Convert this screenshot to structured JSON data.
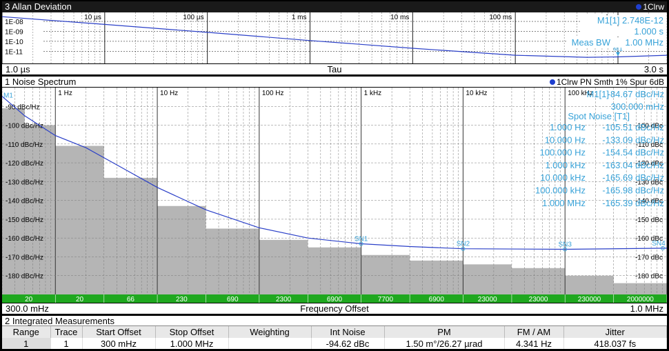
{
  "colors": {
    "trace": "#2a3fc8",
    "marker": "#37a2d8",
    "fill": "#b5b5b5",
    "grid": "#7a7a7a",
    "band": "#1fa81f"
  },
  "allan": {
    "title": "3 Allan Deviation",
    "trace_label": "1Clrw",
    "x_left": "1.0 µs",
    "x_center": "Tau",
    "x_right": "3.0 s",
    "marker_name": "M1",
    "marker_text_1": "M1[1] 2.748E-12",
    "marker_text_2": "1.000 s",
    "meas_bw_label": "Meas BW",
    "meas_bw_value": "1.00 MHz"
  },
  "noise": {
    "title": "1 Noise Spectrum",
    "trace_label": "1Clrw PN Smth 1% Spur 6dB",
    "marker_name": "M1",
    "marker_readout": "M1[1]",
    "marker_value": "-84.67 dBc/Hz",
    "marker_freq": "300.000 mHz",
    "spot_title": "Spot Noise [T1]",
    "spot_rows": [
      {
        "f": "1.000 Hz",
        "v": "-105.51 dBc/Hz"
      },
      {
        "f": "10.000 Hz",
        "v": "-133.09 dBc/Hz"
      },
      {
        "f": "100.000 Hz",
        "v": "-154.54 dBc/Hz"
      },
      {
        "f": "1.000 kHz",
        "v": "-163.04 dBc/Hz"
      },
      {
        "f": "10.000 kHz",
        "v": "-165.69 dBc/Hz"
      },
      {
        "f": "100.000 kHz",
        "v": "-165.98 dBc/Hz"
      },
      {
        "f": "1.000 MHz",
        "v": "-165.39 dBc/Hz"
      }
    ],
    "x_left": "300.0 mHz",
    "x_center": "Frequency Offset",
    "x_right": "1.0 MHz"
  },
  "integrated": {
    "title": "2 Integrated Measurements",
    "headers": [
      "Range",
      "Trace",
      "Start Offset",
      "Stop Offset",
      "Weighting",
      "Int Noise",
      "PM",
      "FM / AM",
      "Jitter"
    ],
    "row": [
      "1",
      "1",
      "300 mHz",
      "1.000 MHz",
      "",
      "-94.62 dBc",
      "1.50 m°/26.27 µrad",
      "4.341 Hz",
      "418.037 fs"
    ]
  },
  "chart_data": [
    {
      "type": "line",
      "title": "3 Allan Deviation",
      "xlabel": "Tau",
      "x_scale": "log",
      "y_scale": "log",
      "xlim": [
        "1.0 µs",
        "3.0 s"
      ],
      "x_tick_labels": [
        "10 µs",
        "100 µs",
        "1 ms",
        "10 ms",
        "100 ms",
        "1 s"
      ],
      "x_tick_values_s": [
        1e-05,
        0.0001,
        0.001,
        0.01,
        0.1,
        1
      ],
      "y_tick_labels": [
        "1E-08",
        "1E-09",
        "1E-10",
        "1E-11"
      ],
      "y_tick_values": [
        1e-08,
        1e-09,
        1e-10,
        1e-11
      ],
      "xlim_s": [
        1e-06,
        3
      ],
      "ylim": [
        6e-13,
        8e-08
      ],
      "series": [
        {
          "name": "1Clrw",
          "x": [
            1e-06,
            1e-05,
            0.0001,
            0.001,
            0.01,
            0.1,
            0.5,
            1,
            3
          ],
          "y": [
            3e-08,
            5e-09,
            8e-10,
            1.2e-10,
            2e-11,
            4e-12,
            2.5e-12,
            2.748e-12,
            4e-12
          ]
        }
      ],
      "markers": [
        {
          "name": "M1",
          "x": 1,
          "y": 2.748e-12
        }
      ]
    },
    {
      "type": "line",
      "title": "1 Noise Spectrum",
      "xlabel": "Frequency Offset",
      "x_scale": "log",
      "xlim_hz": [
        0.3,
        1000000
      ],
      "ylim": [
        -190,
        -80
      ],
      "x_tick_labels": [
        "1 Hz",
        "10 Hz",
        "100 Hz",
        "1 kHz",
        "10 kHz",
        "100 kHz"
      ],
      "x_tick_values": [
        1,
        10,
        100,
        1000,
        10000,
        100000
      ],
      "y_tick_labels_left": [
        "-90 dBc/Hz",
        "-100 dBc/Hz",
        "-110 dBc/Hz",
        "-120 dBc/Hz",
        "-130 dBc/Hz",
        "-140 dBc/Hz",
        "-150 dBc/Hz",
        "-160 dBc/Hz",
        "-170 dBc/Hz",
        "-180 dBc/Hz"
      ],
      "y_tick_labels_right": [
        "-100 dBc",
        "-110 dBc",
        "-120 dBc",
        "-130 dBc",
        "-140 dBc",
        "-150 dBc",
        "-160 dBc",
        "-170 dBc",
        "-180 dBc"
      ],
      "y_tick_values": [
        -90,
        -100,
        -110,
        -120,
        -130,
        -140,
        -150,
        -160,
        -170,
        -180
      ],
      "series": [
        {
          "name": "1Clrw PN Smth 1% Spur 6dB",
          "x": [
            0.3,
            0.5,
            1,
            2,
            5,
            10,
            30,
            100,
            300,
            1000,
            3000,
            10000,
            100000,
            1000000
          ],
          "y": [
            -84.67,
            -95,
            -105.51,
            -112,
            -124,
            -133.09,
            -145,
            -154.54,
            -160,
            -163.04,
            -164.5,
            -165.69,
            -165.98,
            -165.39
          ]
        },
        {
          "name": "fill",
          "x": [
            0.3,
            0.5,
            1,
            3,
            10,
            30,
            100,
            300,
            1000,
            3000,
            10000,
            30000,
            100000,
            300000,
            1000000
          ],
          "y": [
            -91,
            -100,
            -111,
            -128,
            -143,
            -155,
            -161,
            -165,
            -169,
            -172,
            -174,
            -176,
            -180,
            -184,
            -187
          ]
        }
      ],
      "spot_markers": [
        {
          "name": "SN1",
          "x": 1000,
          "y": -163.04
        },
        {
          "name": "SN2",
          "x": 10000,
          "y": -165.69
        },
        {
          "name": "SN3",
          "x": 100000,
          "y": -165.98
        },
        {
          "name": "SN4",
          "x": 1000000,
          "y": -165.39
        }
      ],
      "marker": {
        "name": "M1",
        "x": 0.3,
        "y": -84.67
      },
      "band_labels": [
        "20",
        "20",
        "66",
        "230",
        "690",
        "2300",
        "6900",
        "7700",
        "6900",
        "23000",
        "23000",
        "230000",
        "2000000"
      ],
      "band_edges_hz": [
        0.3,
        1,
        3,
        10,
        30,
        100,
        300,
        1000,
        3000,
        10000,
        30000,
        100000,
        300000,
        1000000
      ]
    }
  ]
}
